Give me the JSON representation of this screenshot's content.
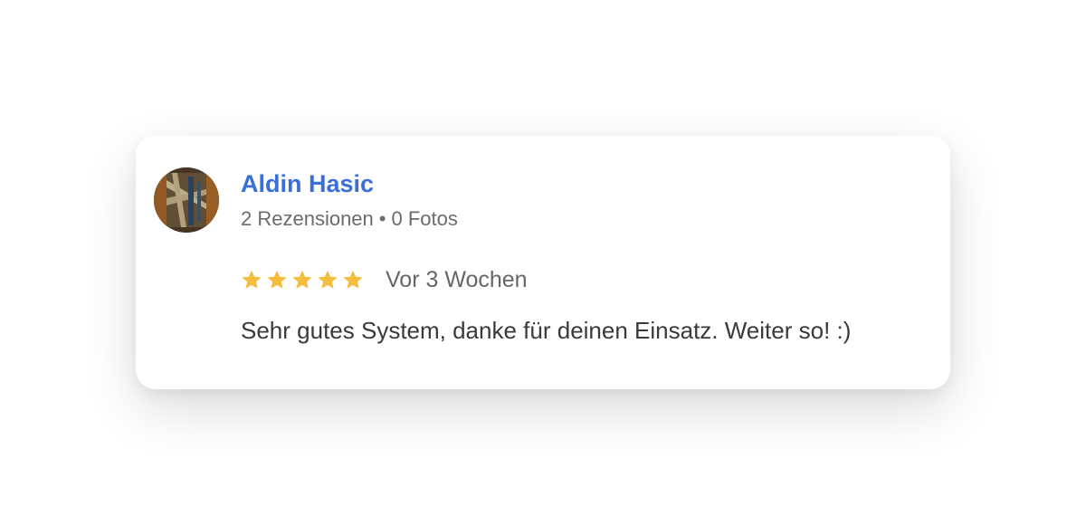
{
  "review": {
    "reviewer_name": "Aldin Hasic",
    "reviews_count": "2 Rezensionen",
    "separator": "•",
    "photos_count": "0 Fotos",
    "rating": 5,
    "rating_max": 5,
    "date": "Vor 3 Wochen",
    "text": "Sehr gutes System, danke für deinen Einsatz. Weiter so! :)"
  },
  "colors": {
    "name": "#3b6fd8",
    "star": "#f4bd3b",
    "meta": "#6b6b6b",
    "text": "#3a3a3a"
  },
  "icons": {
    "avatar": "profile-photo",
    "star": "star-icon"
  }
}
